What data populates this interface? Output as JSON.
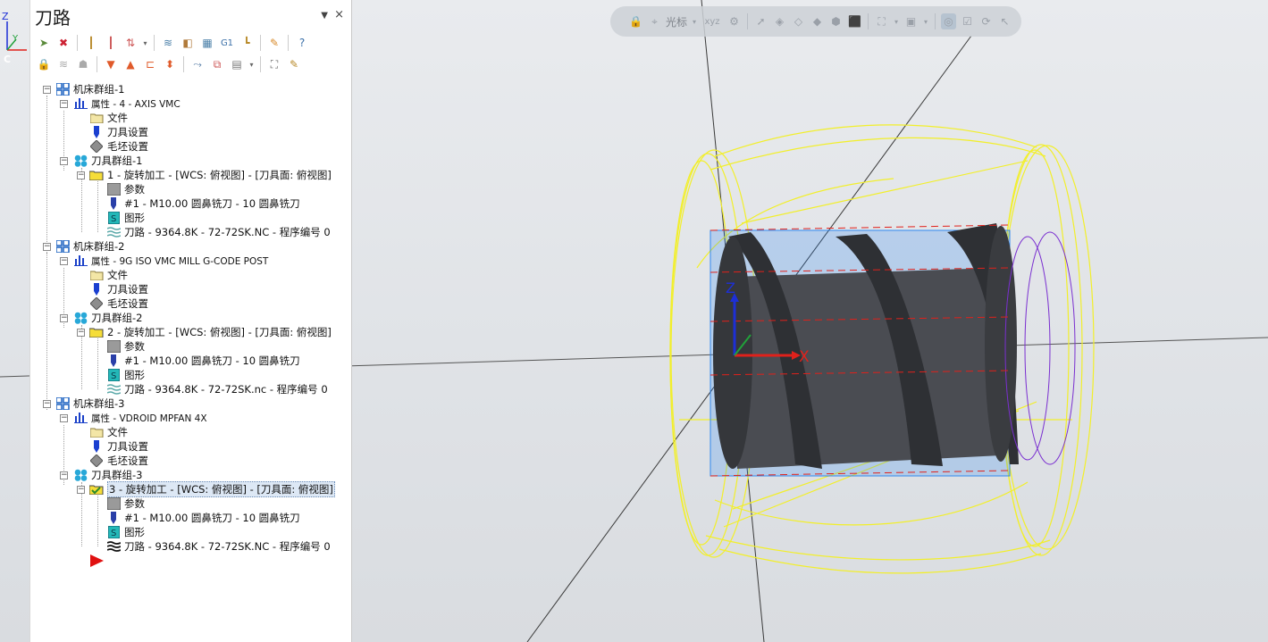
{
  "panel": {
    "title": "刀路",
    "pin_glyph": "▼",
    "close_glyph": "×"
  },
  "toolbar_row1": [
    "select-all-operations-icon",
    "select-all-dirty-icon",
    "regenerate-icon",
    "regenerate-dirty-icon",
    "toggle-selected-icon",
    "toolpath-display-icon",
    "verify-icon",
    "backplot-icon",
    "g1-simulate-icon",
    "post-icon",
    "highspeed-icon",
    "help-icon"
  ],
  "toolbar_row2": [
    "lock-icon",
    "toggle-display-icon",
    "toggle-post-icon",
    "move-down-icon",
    "move-up-icon",
    "insert-arrow-icon",
    "scroll-icon",
    "single-select-icon",
    "display-options-icon",
    "toolpath-manager-icon",
    "verify-selected-icon"
  ],
  "tree": {
    "machine_groups": [
      {
        "label": "机床群组-1",
        "properties": "属性 - 4 - AXIS VMC",
        "files": "文件",
        "tool_settings": "刀具设置",
        "stock_setup": "毛坯设置",
        "toolpath_group": "刀具群组-1",
        "operation": "1 - 旋转加工 - [WCS: 俯视图] - [刀具面: 俯视图]",
        "parameters": "参数",
        "tool": "#1 - M10.00 圆鼻铣刀 - 10 圆鼻铣刀",
        "geometry": "图形",
        "toolpath": "刀路 - 9364.8K - 72-72SK.NC - 程序编号 0"
      },
      {
        "label": "机床群组-2",
        "properties": "属性 - 9G ISO VMC MILL G-CODE POST",
        "files": "文件",
        "tool_settings": "刀具设置",
        "stock_setup": "毛坯设置",
        "toolpath_group": "刀具群组-2",
        "operation": "2 - 旋转加工 - [WCS: 俯视图] - [刀具面: 俯视图]",
        "parameters": "参数",
        "tool": "#1 - M10.00 圆鼻铣刀 - 10 圆鼻铣刀",
        "geometry": "图形",
        "toolpath": "刀路 - 9364.8K - 72-72SK.nc - 程序编号 0"
      },
      {
        "label": "机床群组-3",
        "properties": "属性 - VDROID MPFAN 4X",
        "files": "文件",
        "tool_settings": "刀具设置",
        "stock_setup": "毛坯设置",
        "toolpath_group": "刀具群组-3",
        "operation": "3 - 旋转加工 - [WCS: 俯视图] - [刀具面: 俯视图]",
        "parameters": "参数",
        "tool": "#1 - M10.00 圆鼻铣刀 - 10 圆鼻铣刀",
        "geometry": "图形",
        "toolpath": "刀路 - 9364.8K - 72-72SK.NC - 程序编号 0"
      }
    ]
  },
  "view_toolbar": {
    "cursor_label": "光标",
    "xyz_label": "xyz"
  },
  "viewport": {
    "axis_z": "Z",
    "axis_x": "X",
    "gnomon_z": "Z",
    "gnomon_c": "C",
    "gnomon_y": "Y"
  },
  "colors": {
    "toolpath_yellow": "#f2ef2a",
    "toolpath_blue": "#1e7ff0",
    "part_dark": "#3b3d42",
    "axis_red": "#e0211b",
    "axis_blue": "#1d2fd6",
    "axis_green": "#21a13a",
    "insert_marker": "#e01010",
    "selected_bg": "#dde8f5"
  }
}
